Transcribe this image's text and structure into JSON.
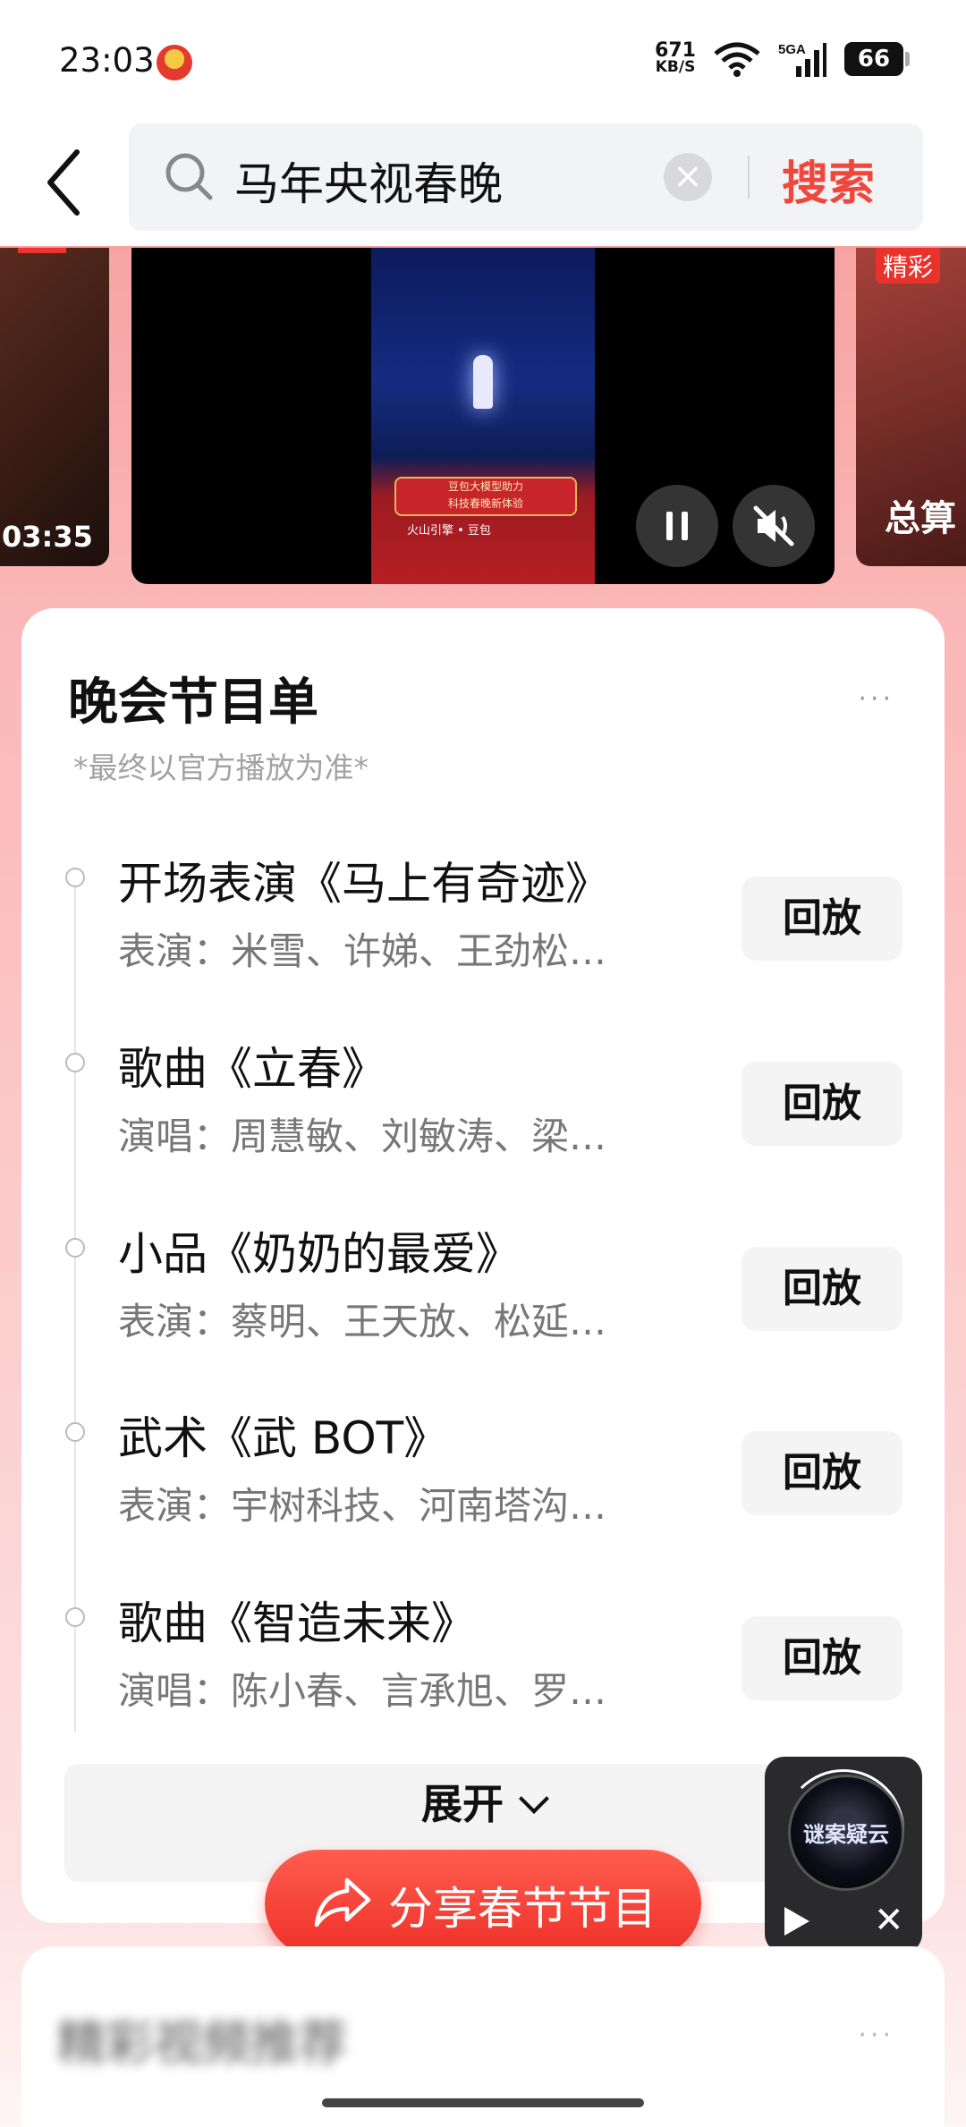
{
  "status_bar": {
    "time": "23:03",
    "net_speed_value": "671",
    "net_speed_unit": "KB/S",
    "signal_label": "5G",
    "battery": "66"
  },
  "search": {
    "query": "马年央视春晚",
    "clear_symbol": "×",
    "button_label": "搜索"
  },
  "carousel": {
    "left_duration": "03:35",
    "right_tag": "精彩",
    "right_caption": "总算",
    "poster_banner_line1": "豆包大模型助力",
    "poster_banner_line2": "科技春晚新体验",
    "poster_brand": "火山引擎 • 豆包"
  },
  "program_card": {
    "title": "晚会节目单",
    "more_symbol": "···",
    "note": "*最终以官方播放为准*",
    "replay_label": "回放",
    "expand_label": "展开",
    "items": [
      {
        "title": "开场表演《马上有奇迹》",
        "performers": "表演：米雪、许娣、王劲松…"
      },
      {
        "title": "歌曲《立春》",
        "performers": "演唱：周慧敏、刘敏涛、梁…"
      },
      {
        "title": "小品《奶奶的最爱》",
        "performers": "表演：蔡明、王天放、松延…"
      },
      {
        "title": "武术《武 BOT》",
        "performers": "表演：宇树科技、河南塔沟…"
      },
      {
        "title": "歌曲《智造未来》",
        "performers": "演唱：陈小春、言承旭、罗…"
      }
    ]
  },
  "share_button": {
    "label": "分享春节节目"
  },
  "mini_player": {
    "disc_text": "谜案疑云",
    "close_symbol": "✕"
  },
  "second_card": {
    "title_blurred": "精彩视频推荐",
    "more_symbol": "···"
  }
}
